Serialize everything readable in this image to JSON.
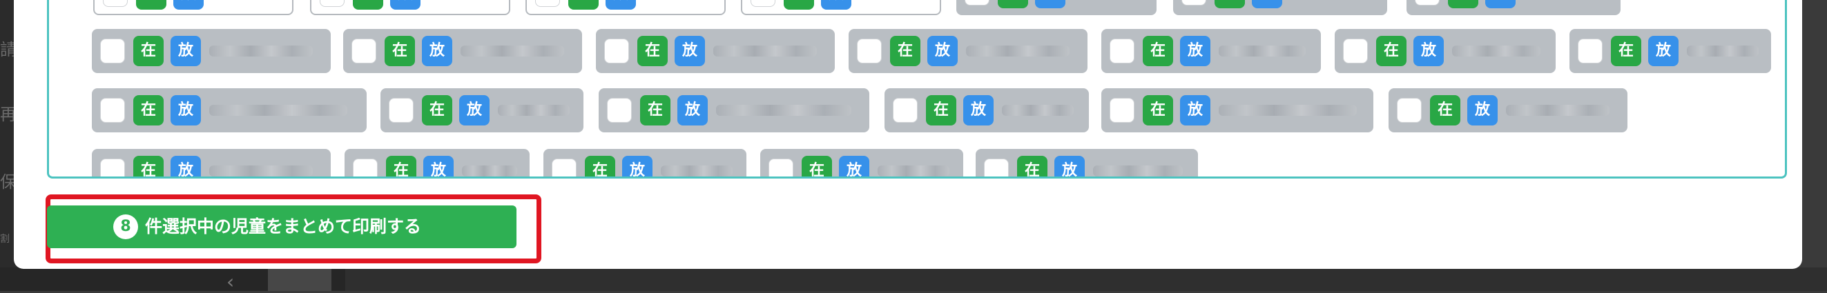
{
  "background": {
    "left_fragments": [
      "請",
      "再",
      "保",
      "割"
    ]
  },
  "student_list": {
    "tags": {
      "present": "在",
      "after_school": "放"
    },
    "rows": [
      {
        "chips": 7
      },
      {
        "chips": 7
      },
      {
        "chips": 6
      },
      {
        "chips": 5
      }
    ]
  },
  "footer": {
    "selected_count": "8",
    "print_label": "件選択中の児童をまとめて印刷する"
  },
  "colors": {
    "accent_green": "#2eb053",
    "present_tag": "#29a745",
    "after_school_tag": "#3791ea",
    "list_border": "#4cc3c0",
    "highlight_red": "#e01622"
  }
}
